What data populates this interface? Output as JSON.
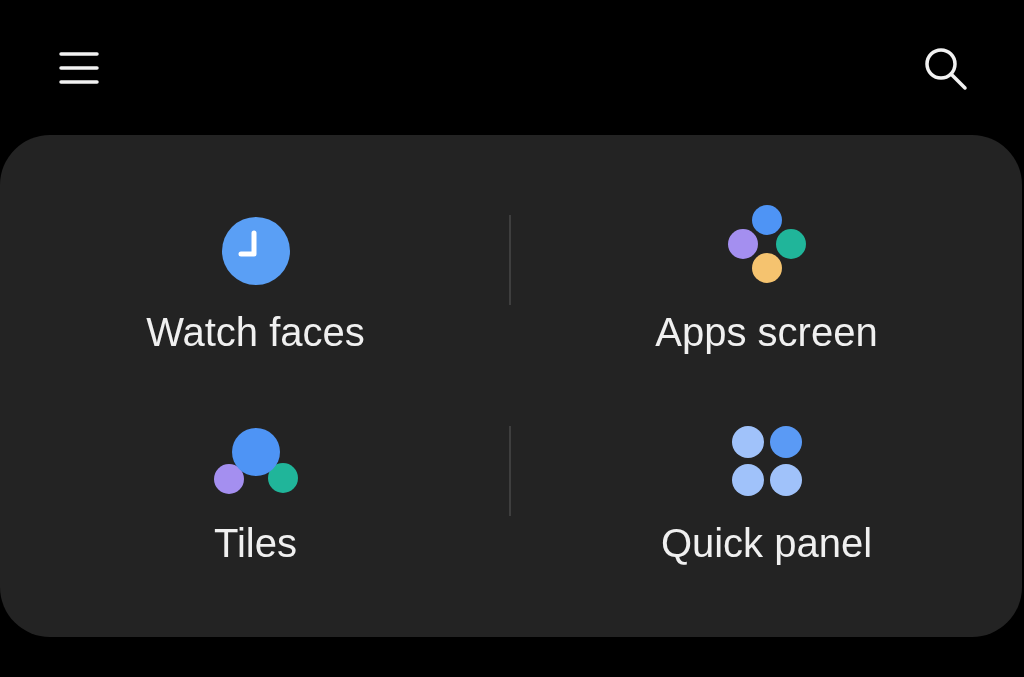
{
  "shortcuts": [
    {
      "label": "Watch faces",
      "kind": "clock"
    },
    {
      "label": "Apps screen",
      "kind": "apps"
    },
    {
      "label": "Tiles",
      "kind": "tiles"
    },
    {
      "label": "Quick panel",
      "kind": "quick"
    }
  ]
}
